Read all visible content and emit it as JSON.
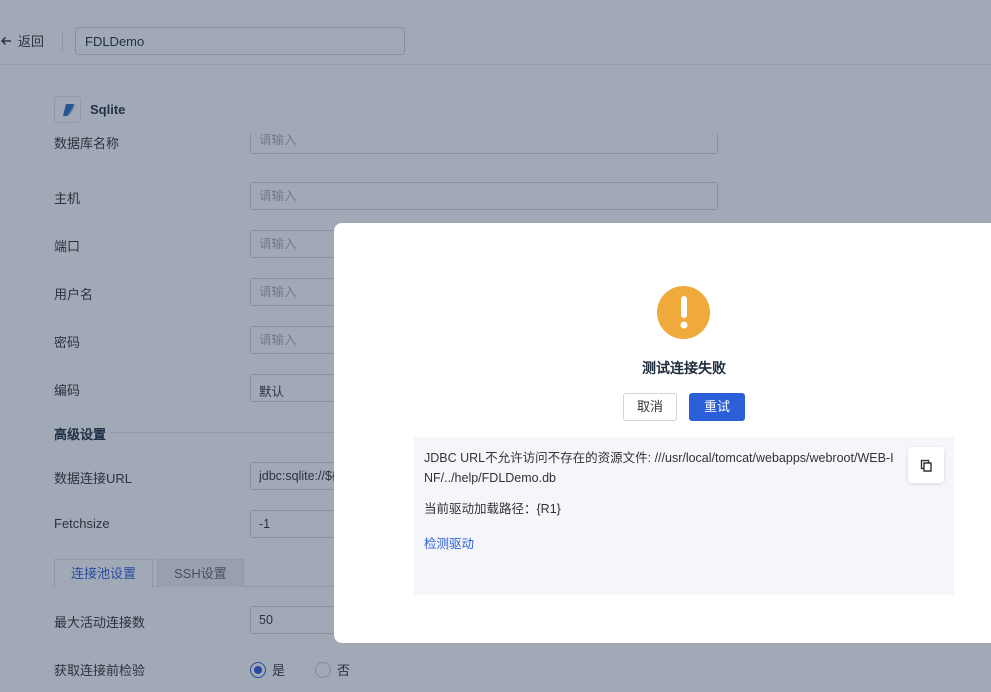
{
  "topbar": {
    "back_label": "返回",
    "connection_name": "FDLDemo"
  },
  "database": {
    "title": "Sqlite"
  },
  "form": {
    "db_name": {
      "label": "数据库名称",
      "placeholder": "请输入"
    },
    "host": {
      "label": "主机",
      "placeholder": "请输入"
    },
    "port": {
      "label": "端口",
      "placeholder": "请输入"
    },
    "username": {
      "label": "用户名",
      "placeholder": "请输入"
    },
    "password": {
      "label": "密码",
      "placeholder": "请输入"
    },
    "encoding": {
      "label": "编码",
      "value": "默认"
    },
    "advanced_title": "高级设置",
    "jdbc_url": {
      "label": "数据连接URL",
      "value": "jdbc:sqlite://${"
    },
    "fetchsize": {
      "label": "Fetchsize",
      "value": "-1"
    }
  },
  "tabs": {
    "pool": "连接池设置",
    "ssh": "SSH设置"
  },
  "pool": {
    "max_active": {
      "label": "最大活动连接数",
      "value": "50"
    },
    "validate": {
      "label": "获取连接前检验",
      "yes": "是",
      "no": "否",
      "selected": "是"
    }
  },
  "dialog": {
    "icon": "warning-icon",
    "title": "测试连接失败",
    "cancel_label": "取消",
    "retry_label": "重试",
    "error_message": "JDBC URL不允许访问不存在的资源文件: ///usr/local/tomcat/webapps/webroot/WEB-INF/../help/FDLDemo.db",
    "driver_path": "当前驱动加载路径：{R1}",
    "check_driver_label": "检测驱动",
    "copy_icon": "copy-icon"
  },
  "colors": {
    "primary": "#2b5fd8",
    "warning": "#f0a93b",
    "overlay": "rgba(33,50,80,0.42)"
  }
}
